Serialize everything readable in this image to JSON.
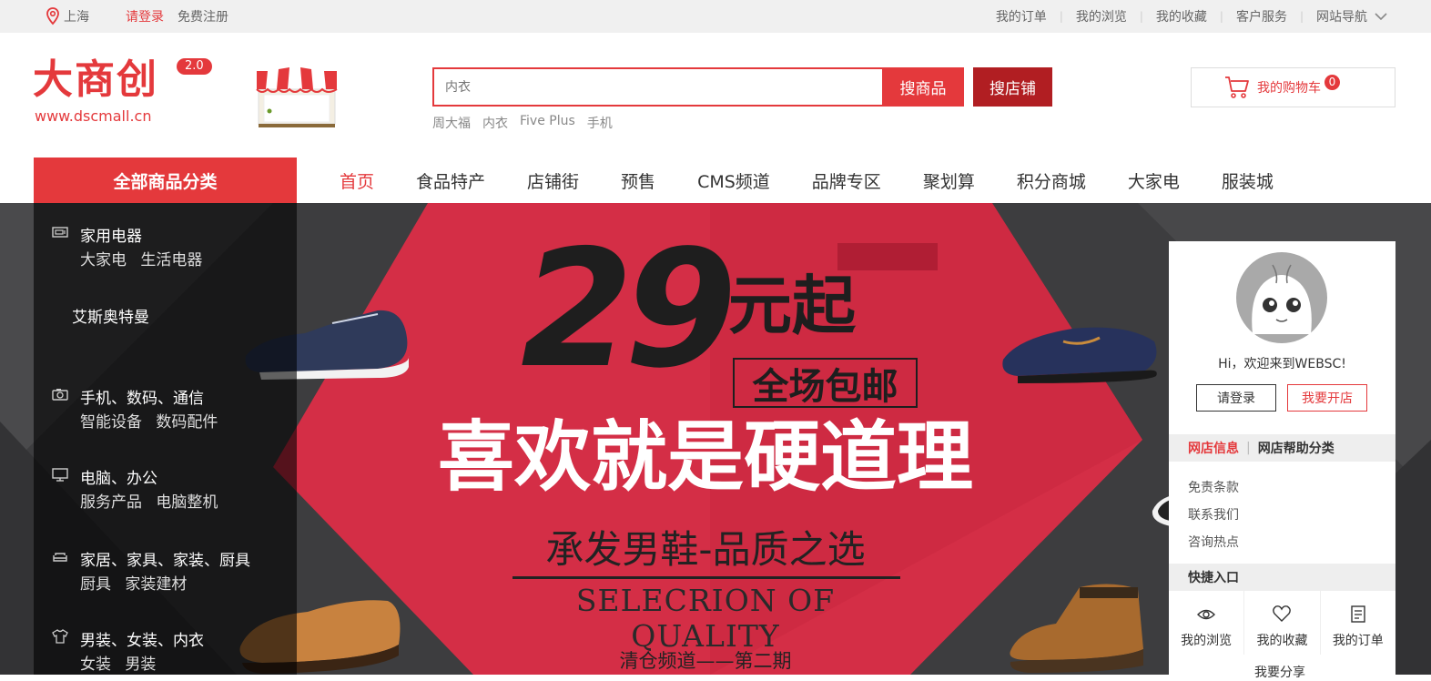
{
  "topbar": {
    "city": "上海",
    "login": "请登录",
    "register": "免费注册",
    "links": [
      "我的订单",
      "我的浏览",
      "我的收藏",
      "客户服务",
      "网站导航"
    ]
  },
  "header": {
    "logo_text": "大商创",
    "logo_version": "2.0",
    "logo_url": "www.dscmall.cn",
    "search_placeholder": "内衣",
    "search_goods_btn": "搜商品",
    "search_shop_btn": "搜店铺",
    "hotwords": [
      "周大福",
      "内衣",
      "Five Plus",
      "手机"
    ],
    "cart_label": "我的购物车",
    "cart_count": "0"
  },
  "nav": {
    "all_categories": "全部商品分类",
    "items": [
      "首页",
      "食品特产",
      "店铺街",
      "预售",
      "CMS频道",
      "品牌专区",
      "聚划算",
      "积分商城",
      "大家电",
      "服装城"
    ]
  },
  "categories": [
    {
      "title": "家用电器",
      "subs": [
        "大家电",
        "生活电器"
      ],
      "icon": "appliance-icon"
    },
    {
      "title": "艾斯奥特曼",
      "subs": [],
      "icon": ""
    },
    {
      "title": "手机、数码、通信",
      "subs": [
        "智能设备",
        "数码配件"
      ],
      "icon": "camera-icon"
    },
    {
      "title": "电脑、办公",
      "subs": [
        "服务产品",
        "电脑整机"
      ],
      "icon": "monitor-icon"
    },
    {
      "title": "家居、家具、家装、厨具",
      "subs": [
        "厨具",
        "家装建材"
      ],
      "icon": "sofa-icon"
    },
    {
      "title": "男装、女装、内衣",
      "subs": [
        "女装",
        "男装"
      ],
      "icon": "shirt-icon"
    }
  ],
  "banner": {
    "price": "29",
    "price_suffix": "元起",
    "free_shipping": "全场包邮",
    "slogan": "喜欢就是硬道理",
    "subtitle": "承发男鞋-品质之选",
    "english": "SELECRION OF QUALITY",
    "period": "清仓频道——第二期"
  },
  "user_panel": {
    "welcome": "Hi，欢迎来到WEBSC!",
    "login_btn": "请登录",
    "open_shop_btn": "我要开店",
    "tab_info": "网店信息",
    "tab_help": "网店帮助分类",
    "links": [
      "免责条款",
      "联系我们",
      "咨询热点"
    ],
    "quick_title": "快捷入口",
    "quick": [
      "我的浏览",
      "我的收藏",
      "我的订单"
    ],
    "more": "我要分享"
  },
  "colors": {
    "accent": "#e4393c",
    "dark_accent": "#b11e22"
  }
}
